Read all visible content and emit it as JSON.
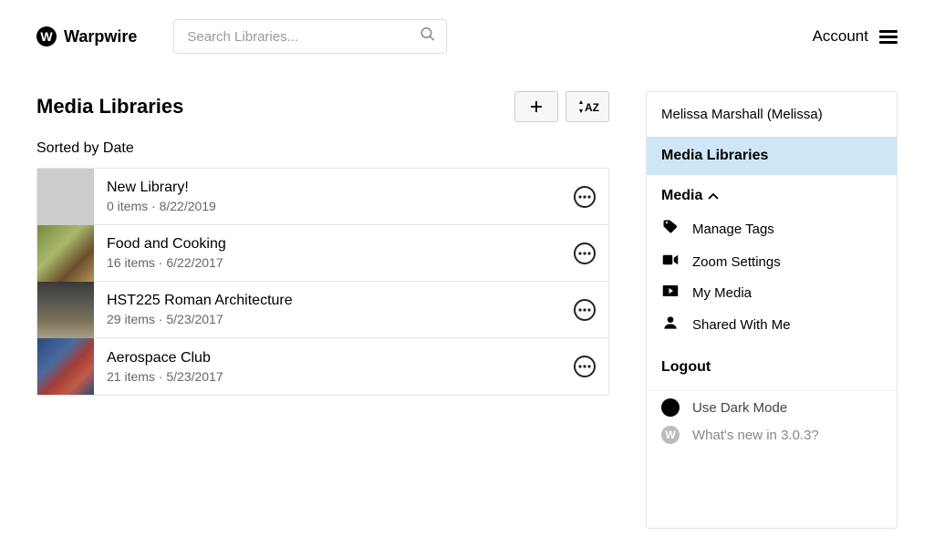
{
  "brand": {
    "letter": "W",
    "name": "Warpwire"
  },
  "search": {
    "placeholder": "Search Libraries..."
  },
  "account": {
    "label": "Account"
  },
  "page": {
    "title": "Media Libraries",
    "sorted_by": "Sorted by Date"
  },
  "libraries": [
    {
      "name": "New Library!",
      "meta": "0 items · 8/22/2019",
      "thumb": "blank"
    },
    {
      "name": "Food and Cooking",
      "meta": "16 items · 6/22/2017",
      "thumb": "food"
    },
    {
      "name": "HST225 Roman Architecture",
      "meta": "29 items · 5/23/2017",
      "thumb": "rome"
    },
    {
      "name": "Aerospace Club",
      "meta": "21 items · 5/23/2017",
      "thumb": "aero"
    }
  ],
  "panel": {
    "user": "Melissa Marshall (Melissa)",
    "active": "Media Libraries",
    "media_section": "Media",
    "items": [
      {
        "icon": "tag-icon",
        "label": "Manage Tags"
      },
      {
        "icon": "video-icon",
        "label": "Zoom Settings"
      },
      {
        "icon": "play-icon",
        "label": "My Media"
      },
      {
        "icon": "person-icon",
        "label": "Shared With Me"
      }
    ],
    "logout": "Logout",
    "dark_mode": "Use Dark Mode",
    "whats_new": "What's new in 3.0.3?",
    "whats_new_letter": "W"
  }
}
